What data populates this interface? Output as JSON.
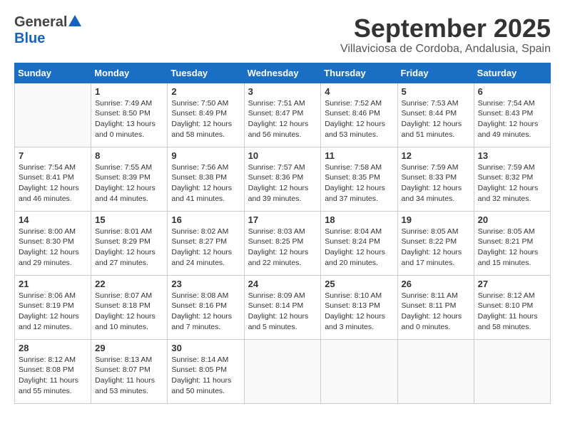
{
  "header": {
    "logo_general": "General",
    "logo_blue": "Blue",
    "month": "September 2025",
    "location": "Villaviciosa de Cordoba, Andalusia, Spain"
  },
  "weekdays": [
    "Sunday",
    "Monday",
    "Tuesday",
    "Wednesday",
    "Thursday",
    "Friday",
    "Saturday"
  ],
  "weeks": [
    [
      {
        "day": "",
        "info": ""
      },
      {
        "day": "1",
        "info": "Sunrise: 7:49 AM\nSunset: 8:50 PM\nDaylight: 13 hours\nand 0 minutes."
      },
      {
        "day": "2",
        "info": "Sunrise: 7:50 AM\nSunset: 8:49 PM\nDaylight: 12 hours\nand 58 minutes."
      },
      {
        "day": "3",
        "info": "Sunrise: 7:51 AM\nSunset: 8:47 PM\nDaylight: 12 hours\nand 56 minutes."
      },
      {
        "day": "4",
        "info": "Sunrise: 7:52 AM\nSunset: 8:46 PM\nDaylight: 12 hours\nand 53 minutes."
      },
      {
        "day": "5",
        "info": "Sunrise: 7:53 AM\nSunset: 8:44 PM\nDaylight: 12 hours\nand 51 minutes."
      },
      {
        "day": "6",
        "info": "Sunrise: 7:54 AM\nSunset: 8:43 PM\nDaylight: 12 hours\nand 49 minutes."
      }
    ],
    [
      {
        "day": "7",
        "info": "Sunrise: 7:54 AM\nSunset: 8:41 PM\nDaylight: 12 hours\nand 46 minutes."
      },
      {
        "day": "8",
        "info": "Sunrise: 7:55 AM\nSunset: 8:39 PM\nDaylight: 12 hours\nand 44 minutes."
      },
      {
        "day": "9",
        "info": "Sunrise: 7:56 AM\nSunset: 8:38 PM\nDaylight: 12 hours\nand 41 minutes."
      },
      {
        "day": "10",
        "info": "Sunrise: 7:57 AM\nSunset: 8:36 PM\nDaylight: 12 hours\nand 39 minutes."
      },
      {
        "day": "11",
        "info": "Sunrise: 7:58 AM\nSunset: 8:35 PM\nDaylight: 12 hours\nand 37 minutes."
      },
      {
        "day": "12",
        "info": "Sunrise: 7:59 AM\nSunset: 8:33 PM\nDaylight: 12 hours\nand 34 minutes."
      },
      {
        "day": "13",
        "info": "Sunrise: 7:59 AM\nSunset: 8:32 PM\nDaylight: 12 hours\nand 32 minutes."
      }
    ],
    [
      {
        "day": "14",
        "info": "Sunrise: 8:00 AM\nSunset: 8:30 PM\nDaylight: 12 hours\nand 29 minutes."
      },
      {
        "day": "15",
        "info": "Sunrise: 8:01 AM\nSunset: 8:29 PM\nDaylight: 12 hours\nand 27 minutes."
      },
      {
        "day": "16",
        "info": "Sunrise: 8:02 AM\nSunset: 8:27 PM\nDaylight: 12 hours\nand 24 minutes."
      },
      {
        "day": "17",
        "info": "Sunrise: 8:03 AM\nSunset: 8:25 PM\nDaylight: 12 hours\nand 22 minutes."
      },
      {
        "day": "18",
        "info": "Sunrise: 8:04 AM\nSunset: 8:24 PM\nDaylight: 12 hours\nand 20 minutes."
      },
      {
        "day": "19",
        "info": "Sunrise: 8:05 AM\nSunset: 8:22 PM\nDaylight: 12 hours\nand 17 minutes."
      },
      {
        "day": "20",
        "info": "Sunrise: 8:05 AM\nSunset: 8:21 PM\nDaylight: 12 hours\nand 15 minutes."
      }
    ],
    [
      {
        "day": "21",
        "info": "Sunrise: 8:06 AM\nSunset: 8:19 PM\nDaylight: 12 hours\nand 12 minutes."
      },
      {
        "day": "22",
        "info": "Sunrise: 8:07 AM\nSunset: 8:18 PM\nDaylight: 12 hours\nand 10 minutes."
      },
      {
        "day": "23",
        "info": "Sunrise: 8:08 AM\nSunset: 8:16 PM\nDaylight: 12 hours\nand 7 minutes."
      },
      {
        "day": "24",
        "info": "Sunrise: 8:09 AM\nSunset: 8:14 PM\nDaylight: 12 hours\nand 5 minutes."
      },
      {
        "day": "25",
        "info": "Sunrise: 8:10 AM\nSunset: 8:13 PM\nDaylight: 12 hours\nand 3 minutes."
      },
      {
        "day": "26",
        "info": "Sunrise: 8:11 AM\nSunset: 8:11 PM\nDaylight: 12 hours\nand 0 minutes."
      },
      {
        "day": "27",
        "info": "Sunrise: 8:12 AM\nSunset: 8:10 PM\nDaylight: 11 hours\nand 58 minutes."
      }
    ],
    [
      {
        "day": "28",
        "info": "Sunrise: 8:12 AM\nSunset: 8:08 PM\nDaylight: 11 hours\nand 55 minutes."
      },
      {
        "day": "29",
        "info": "Sunrise: 8:13 AM\nSunset: 8:07 PM\nDaylight: 11 hours\nand 53 minutes."
      },
      {
        "day": "30",
        "info": "Sunrise: 8:14 AM\nSunset: 8:05 PM\nDaylight: 11 hours\nand 50 minutes."
      },
      {
        "day": "",
        "info": ""
      },
      {
        "day": "",
        "info": ""
      },
      {
        "day": "",
        "info": ""
      },
      {
        "day": "",
        "info": ""
      }
    ]
  ]
}
